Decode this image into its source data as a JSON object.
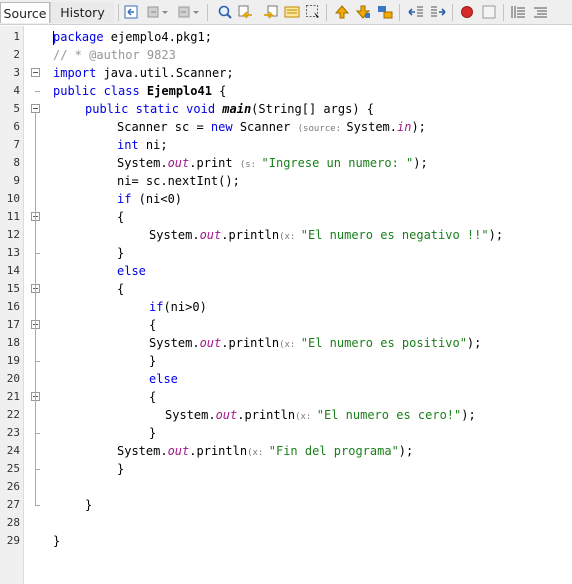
{
  "tabs": {
    "source": "Source",
    "history": "History"
  },
  "toolbar_icons": [
    "last-edit-icon",
    "back-icon",
    "forward-icon",
    "find-icon",
    "find-previous-icon",
    "find-next-icon",
    "toggle-highlight-icon",
    "select-icon",
    "previous-bookmark-icon",
    "next-bookmark-icon",
    "toggle-bookmark-icon",
    "shift-left-icon",
    "shift-right-icon",
    "record-macro-icon",
    "stop-macro-icon",
    "comment-icon",
    "uncomment-icon"
  ],
  "line_numbers": [
    "1",
    "2",
    "3",
    "4",
    "5",
    "6",
    "7",
    "8",
    "9",
    "10",
    "11",
    "12",
    "13",
    "14",
    "15",
    "16",
    "17",
    "18",
    "19",
    "20",
    "21",
    "22",
    "23",
    "24",
    "25",
    "26",
    "27",
    "28",
    "29"
  ],
  "code": {
    "l1": {
      "kw": "package",
      "rest": " ejemplo4.pkg1;"
    },
    "l2": {
      "comment": "// * @author 9823"
    },
    "l3": {
      "kw": "import",
      "rest": " java.util.Scanner;"
    },
    "l4": {
      "kw": "public class",
      "cls": " Ejemplo41",
      "rest": " {"
    },
    "l5": {
      "kw": "public static void",
      "method": " main",
      "rest": "(String[] args) {"
    },
    "l6": {
      "a": "Scanner sc = ",
      "kw": "new",
      "b": " Scanner ",
      "hint": "(source: ",
      "c": "System.",
      "fld": "in",
      "d": ");"
    },
    "l7": {
      "kw": "int",
      "rest": " ni;"
    },
    "l8": {
      "a": "System.",
      "fld": "out",
      "b": ".print ",
      "hint": "(s: ",
      "str": "\"Ingrese un numero: \"",
      "c": ");"
    },
    "l9": {
      "text": "ni= sc.nextInt();"
    },
    "l10": {
      "kw": "if",
      "rest": " (ni<0)"
    },
    "l11": {
      "text": "{"
    },
    "l12": {
      "a": "System.",
      "fld": "out",
      "b": ".println",
      "hint": "(x: ",
      "str": "\"El numero es negativo !!\"",
      "c": ");"
    },
    "l13": {
      "text": "}"
    },
    "l14": {
      "kw": "else"
    },
    "l15": {
      "text": "{"
    },
    "l16": {
      "kw": "if",
      "rest": "(ni>0)"
    },
    "l17": {
      "text": "{"
    },
    "l18": {
      "a": "System.",
      "fld": "out",
      "b": ".println",
      "hint": "(x: ",
      "str": "\"El numero es positivo\"",
      "c": ");"
    },
    "l19": {
      "text": "}"
    },
    "l20": {
      "kw": "else"
    },
    "l21": {
      "text": "{"
    },
    "l22": {
      "a": "System.",
      "fld": "out",
      "b": ".println",
      "hint": "(x: ",
      "str": "\"El numero es cero!\"",
      "c": ");"
    },
    "l23": {
      "text": "}"
    },
    "l24": {
      "a": "System.",
      "fld": "out",
      "b": ".println",
      "hint": "(x: ",
      "str": "\"Fin del programa\"",
      "c": ");"
    },
    "l25": {
      "text": "}"
    },
    "l27": {
      "text": "}"
    },
    "l29": {
      "text": "}"
    }
  }
}
